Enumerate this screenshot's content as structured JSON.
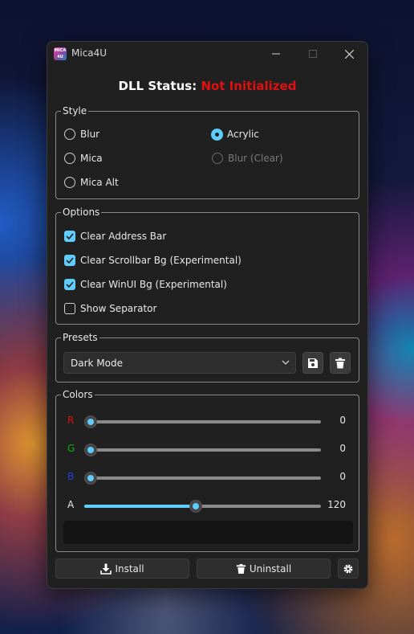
{
  "window": {
    "title": "Mica4U",
    "icon_text": "MICA 4U",
    "controls": {
      "minimize": "minimize-icon",
      "maximize": "maximize-icon",
      "close": "close-icon"
    }
  },
  "dll_status": {
    "label": "DLL Status:",
    "value": "Not Initialized",
    "value_color": "#e01010"
  },
  "style_group": {
    "label": "Style",
    "options": [
      {
        "label": "Blur",
        "checked": false,
        "disabled": false
      },
      {
        "label": "Acrylic",
        "checked": true,
        "disabled": false
      },
      {
        "label": "Mica",
        "checked": false,
        "disabled": false
      },
      {
        "label": "Blur (Clear)",
        "checked": false,
        "disabled": true
      },
      {
        "label": "Mica Alt",
        "checked": false,
        "disabled": false
      }
    ]
  },
  "options_group": {
    "label": "Options",
    "items": [
      {
        "label": "Clear Address Bar",
        "checked": true
      },
      {
        "label": "Clear Scrollbar Bg (Experimental)",
        "checked": true
      },
      {
        "label": "Clear WinUI Bg (Experimental)",
        "checked": true
      },
      {
        "label": "Show Separator",
        "checked": false
      }
    ]
  },
  "presets_group": {
    "label": "Presets",
    "selected": "Dark Mode",
    "save_icon": "save-icon",
    "delete_icon": "trash-icon"
  },
  "colors_group": {
    "label": "Colors",
    "sliders": [
      {
        "label": "R",
        "value": "0",
        "label_color": "#e01010",
        "fraction": 0.0
      },
      {
        "label": "G",
        "value": "0",
        "label_color": "#10b010",
        "fraction": 0.0
      },
      {
        "label": "B",
        "value": "0",
        "label_color": "#2040e0",
        "fraction": 0.0
      },
      {
        "label": "A",
        "value": "120",
        "label_color": "#e8e8e8",
        "fraction": 0.47
      }
    ]
  },
  "buttons": {
    "install": "Install",
    "uninstall": "Uninstall",
    "settings_icon": "gear-icon"
  },
  "accent_color": "#60cdff"
}
